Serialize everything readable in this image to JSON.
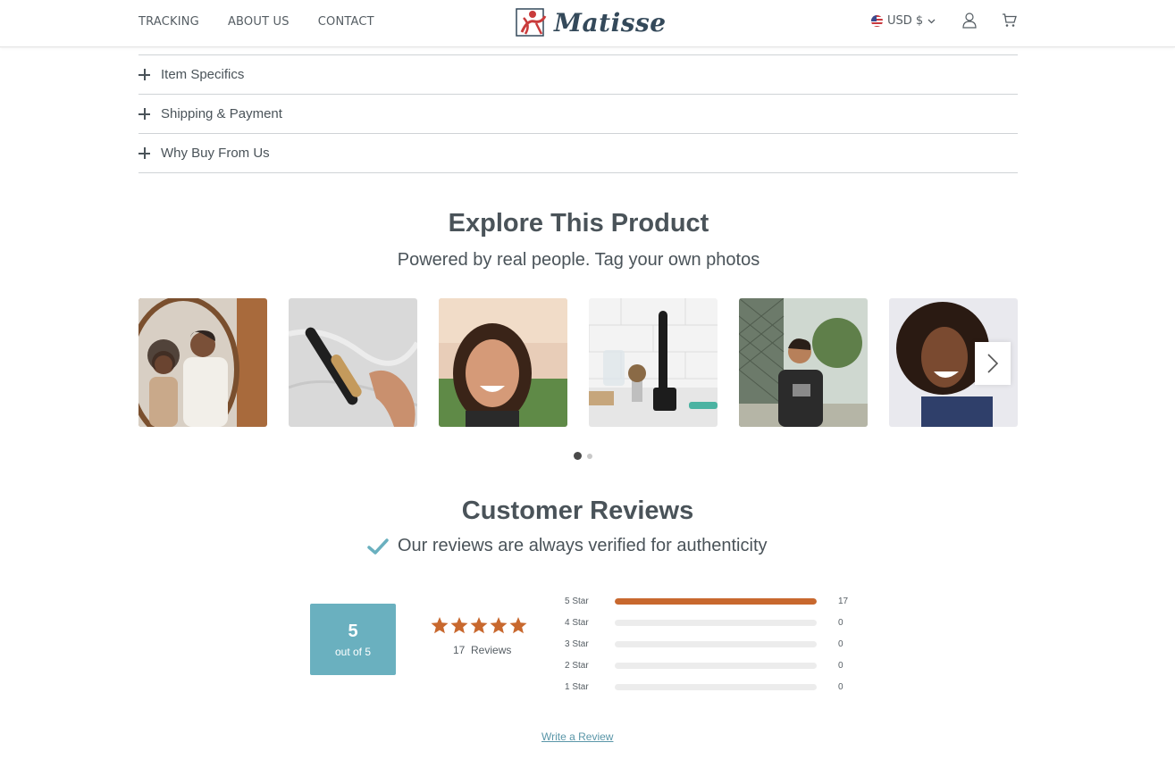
{
  "header": {
    "nav": [
      {
        "label": "TRACKING"
      },
      {
        "label": "ABOUT US"
      },
      {
        "label": "CONTACT"
      }
    ],
    "logo_text": "Matisse",
    "currency": "USD $",
    "icons": {
      "flag": "us-flag-icon",
      "currency_caret": "chevron-down-icon",
      "account": "user-icon",
      "cart": "cart-icon"
    }
  },
  "accordion": [
    {
      "label": "Item Specifics"
    },
    {
      "label": "Shipping & Payment"
    },
    {
      "label": "Why Buy From Us"
    }
  ],
  "explore": {
    "title": "Explore This Product",
    "subtitle": "Powered by real people. Tag your own photos",
    "photos": [
      {
        "subject": "child and man brushing teeth in mirror"
      },
      {
        "subject": "hand holding wooden toothbrush on marble"
      },
      {
        "subject": "smiling woman portrait outdoors"
      },
      {
        "subject": "black toothbrush on stand with shaving kit"
      },
      {
        "subject": "man leaning on fence"
      },
      {
        "subject": "laughing woman with curly hair"
      }
    ],
    "pagination": {
      "pages": 2,
      "current": 1
    }
  },
  "reviews": {
    "title": "Customer Reviews",
    "verified_text": "Our reviews are always verified for authenticity",
    "score": "5",
    "score_suffix": "out of 5",
    "stars": 5,
    "count_label": "17  Reviews",
    "breakdown": [
      {
        "label": "5 Star",
        "count": "17",
        "fraction": 1.0
      },
      {
        "label": "4 Star",
        "count": "0",
        "fraction": 0
      },
      {
        "label": "3 Star",
        "count": "0",
        "fraction": 0
      },
      {
        "label": "2 Star",
        "count": "0",
        "fraction": 0
      },
      {
        "label": "1 Star",
        "count": "0",
        "fraction": 0
      }
    ],
    "write_review": "Write a Review"
  },
  "colors": {
    "accent_teal": "#6ab0bf",
    "star_orange": "#c8682e",
    "text": "#4a5359"
  }
}
